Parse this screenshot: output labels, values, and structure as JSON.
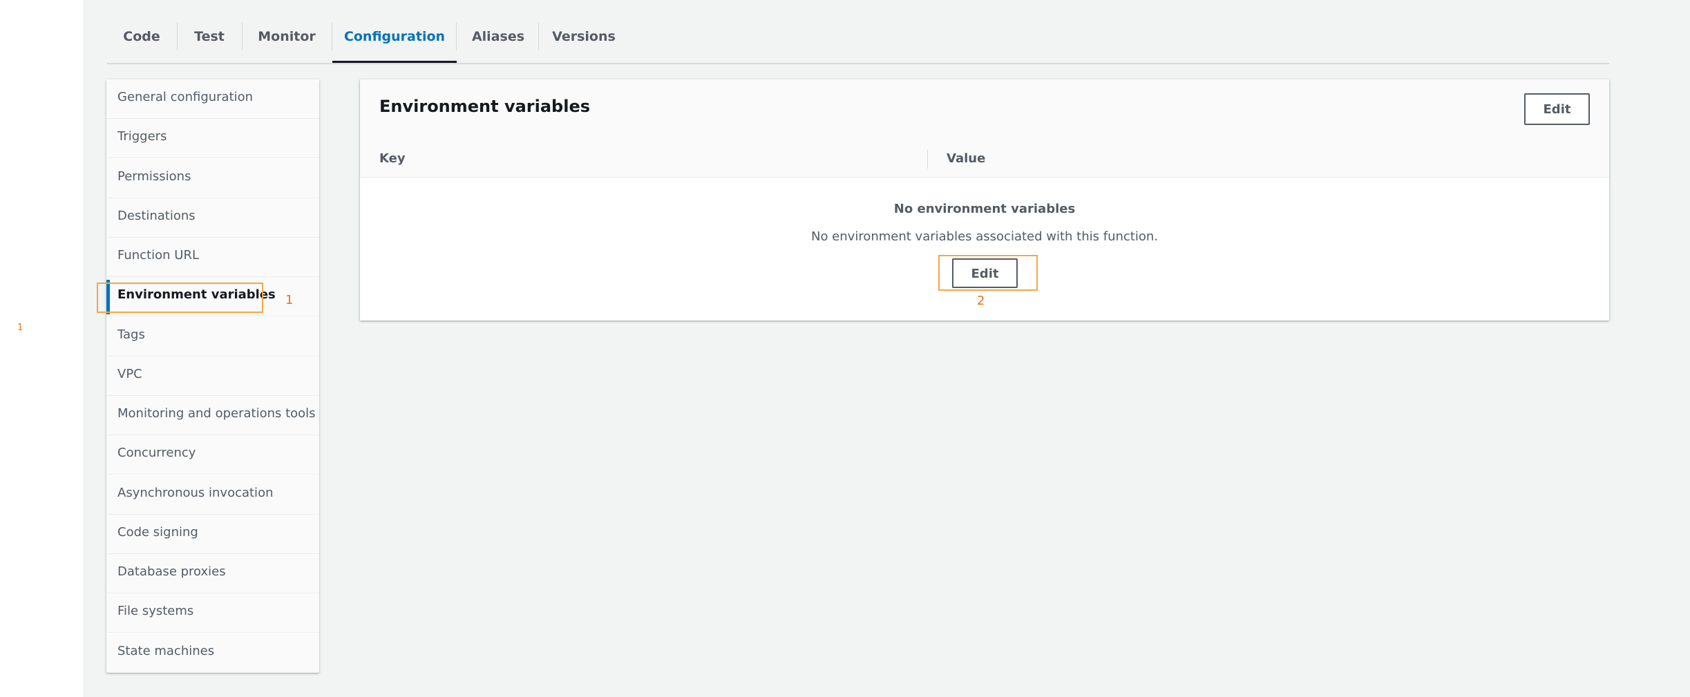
{
  "tabs": [
    "Code",
    "Test",
    "Monitor",
    "Configuration",
    "Aliases",
    "Versions"
  ],
  "active_tab": "Configuration",
  "sidenav": {
    "items": [
      "General configuration",
      "Triggers",
      "Permissions",
      "Destinations",
      "Function URL",
      "Environment variables",
      "Tags",
      "VPC",
      "Monitoring and operations tools",
      "Concurrency",
      "Asynchronous invocation",
      "Code signing",
      "Database proxies",
      "File systems",
      "State machines"
    ],
    "active_item": "Environment variables"
  },
  "panel": {
    "title": "Environment variables",
    "edit_label": "Edit",
    "columns": [
      "Key",
      "Value"
    ],
    "empty_title": "No environment variables",
    "empty_description": "No environment variables associated with this function.",
    "empty_edit_label": "Edit"
  },
  "annotations": {
    "marker_1": "1",
    "marker_2": "2",
    "stray_marker": "1"
  },
  "colors": {
    "accent_blue": "#0073bb",
    "highlight_orange": "#f5a742",
    "background": "#f2f3f3"
  }
}
